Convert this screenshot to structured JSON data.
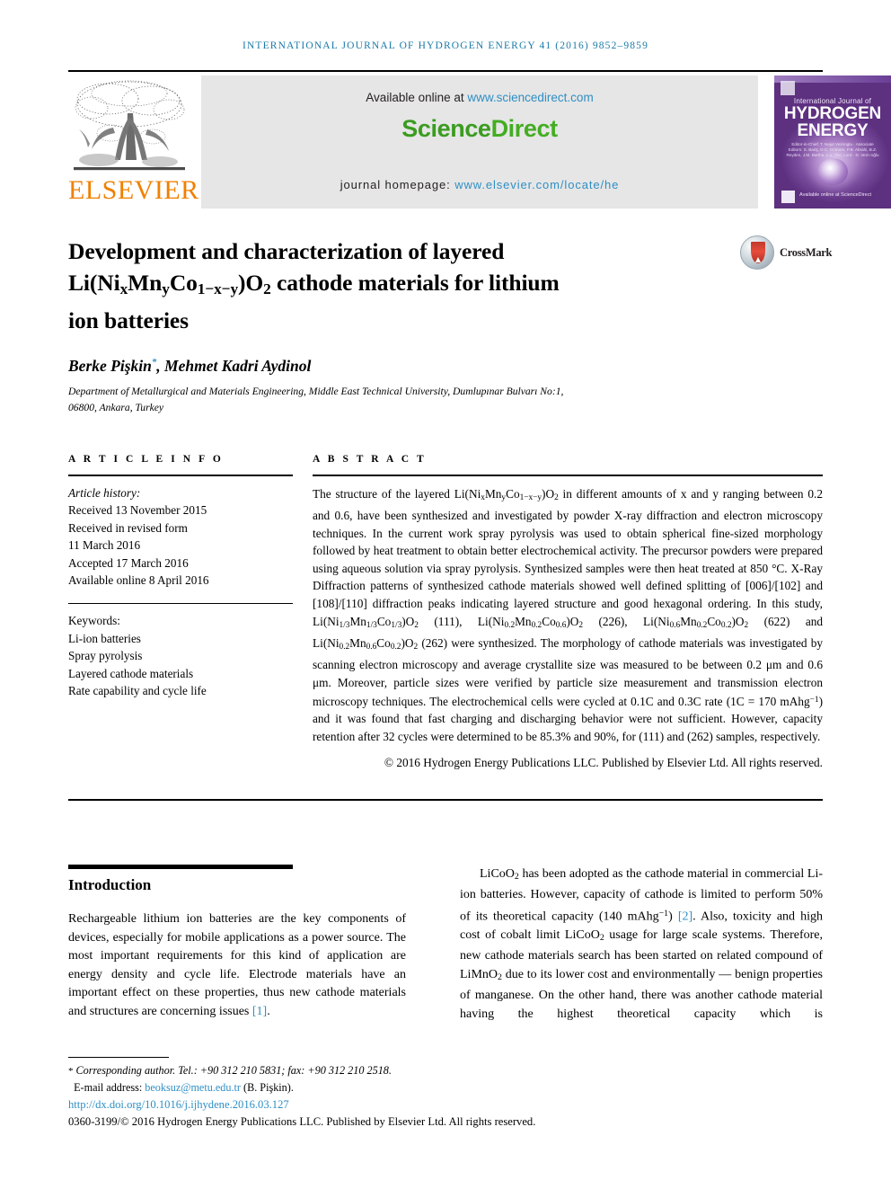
{
  "running_head": "International Journal of Hydrogen Energy 41 (2016) 9852–9859",
  "masthead": {
    "publisher_name": "ELSEVIER",
    "available_prefix": "Available online at ",
    "available_link": "www.sciencedirect.com",
    "sciencedirect_part1": "Science",
    "sciencedirect_part2": "Direct",
    "homepage_prefix": "journal homepage: ",
    "homepage_link": "www.elsevier.com/locate/he",
    "link_color": "#2f8fc4",
    "sciencedirect_green": "#3a9c20",
    "elsevier_orange": "#f08000",
    "band_background": "#e6e6e6"
  },
  "cover": {
    "line1": "International Journal of",
    "line2": "HYDROGEN",
    "line3": "ENERGY",
    "editors": "Editor-in-Chief: T. Nejat Veziroglu · Associate Editors: S. Bariş, D.C. Graham, P.B. Abrahi, B.Z. Reyden, J.M. Bartha, L.a. Tho, Lord · D. Vezi roğlu",
    "sciencedirect_label": "Available online at ScienceDirect"
  },
  "article": {
    "title_line1": "Development and characterization of layered",
    "title_line2_pre": "Li(Ni",
    "title_line2_sub1": "x",
    "title_line2_mid1": "Mn",
    "title_line2_sub2": "y",
    "title_line2_mid2": "Co",
    "title_line2_sub3": "1−x−y",
    "title_line2_mid3": ")O",
    "title_line2_sub4": "2",
    "title_line2_post": " cathode materials for lithium",
    "title_line3": "ion batteries",
    "crossmark_label": "CrossMark",
    "authors": "Berke Pişkin",
    "author_mark": "*",
    "authors_rest": ", Mehmet Kadri Aydinol",
    "affiliation_line1": "Department of Metallurgical and Materials Engineering, Middle East Technical University, Dumlupınar Bulvarı No:1,",
    "affiliation_line2": "06800, Ankara, Turkey"
  },
  "article_info": {
    "heading": "A R T I C L E  I N F O",
    "history_label": "Article history:",
    "history": [
      "Received 13 November 2015",
      "Received in revised form",
      "11 March 2016",
      "Accepted 17 March 2016",
      "Available online 8 April 2016"
    ],
    "keywords_label": "Keywords:",
    "keywords": [
      "Li-ion batteries",
      "Spray pyrolysis",
      "Layered cathode materials",
      "Rate capability and cycle life"
    ]
  },
  "abstract": {
    "heading": "A B S T R A C T",
    "p1_a": "The structure of the layered Li(Ni",
    "p1_b": "Mn",
    "p1_c": "Co",
    "p1_d": ")O",
    "p1_e": " in different amounts of x and y ranging between 0.2 and 0.6, have been synthesized and investigated by powder X-ray diffraction and electron microscopy techniques. In the current work spray pyrolysis was used to obtain spherical fine-sized morphology followed by heat treatment to obtain better electrochemical activity. The precursor powders were prepared using aqueous solution via spray pyrolysis. Synthesized samples were then heat treated at 850 °C. X-Ray Diffraction patterns of synthesized cathode materials showed well defined splitting of [006]/[102] and [108]/[110] diffraction peaks indicating layered structure and good hexagonal ordering. In this study, Li(Ni",
    "f1_s1": "1/3",
    "f1_s2": "1/3",
    "f1_s3": "1/3",
    "f1_lab": "(111), Li(Ni",
    "f2_s1": "0.2",
    "f2_s2": "0.2",
    "f2_s3": "0.6",
    "f2_lab": "(226), Li(Ni",
    "f3_s1": "0.6",
    "f3_s2": "0.2",
    "f3_s3": "0.2",
    "f3_lab": "(622) and Li(Ni",
    "f4_s1": "0.2",
    "f4_s2": "0.6",
    "f4_s3": "0.2",
    "f4_lab": "(262) were synthesized.",
    "p2": "The morphology of cathode materials was investigated by scanning electron microscopy and average crystallite size was measured to be between 0.2 μm and 0.6 μm. Moreover, particle sizes were verified by particle size measurement and transmission electron microscopy techniques. The electrochemical cells were cycled at 0.1C and 0.3C rate (1C = 170 mAhg",
    "p2_sup": "−1",
    "p3": ") and it was found that fast charging and discharging behavior were not sufficient. However, capacity retention after 32 cycles were determined to be 85.3% and 90%, for (111) and (262) samples, respectively.",
    "copyright": "© 2016 Hydrogen Energy Publications LLC. Published by Elsevier Ltd. All rights reserved."
  },
  "introduction": {
    "heading": "Introduction",
    "para1_a": "Rechargeable lithium ion batteries are the key components of devices, especially for mobile applications as a power source. The most important requirements for this kind of application are energy density and cycle life. Electrode materials have an important effect on these properties, thus new cathode materials and structures are concerning issues ",
    "para1_ref": "[1]",
    "para1_b": "."
  },
  "right_column": {
    "p_a": "LiCoO",
    "p_a_sub": "2",
    "p_b": " has been adopted as the cathode material in commercial Li-ion batteries. However, capacity of cathode is limited to perform 50% of its theoretical capacity (140 mAhg",
    "p_b_sup": "−1",
    "p_c": ") ",
    "p_ref": "[2]",
    "p_d": ". Also, toxicity and high cost of cobalt limit LiCoO",
    "p_d_sub": "2",
    "p_e": " usage for large scale systems. Therefore, new cathode materials search has been started on related compound of LiMnO",
    "p_e_sub": "2",
    "p_f": " due to its lower cost and environmentally — benign properties of manganese. On the other hand, there was another cathode material having the highest theoretical capacity which is"
  },
  "footer": {
    "star": "*",
    "corresponding": " Corresponding author. Tel.: +90 312 210 5831; fax: +90 312 210 2518.",
    "email_label": "E-mail address: ",
    "email": "beoksuz@metu.edu.tr",
    "email_suffix": " (B. Pişkin).",
    "doi": "http://dx.doi.org/10.1016/j.ijhydene.2016.03.127",
    "issn": "0360-3199/© 2016 Hydrogen Energy Publications LLC. Published by Elsevier Ltd. All rights reserved."
  }
}
